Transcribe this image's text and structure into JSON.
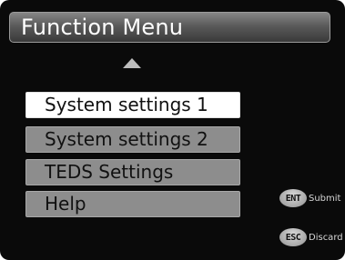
{
  "title": "Function Menu",
  "menu": {
    "items": [
      {
        "label": "System settings 1",
        "selected": true
      },
      {
        "label": "System settings 2",
        "selected": false
      },
      {
        "label": "TEDS Settings",
        "selected": false
      },
      {
        "label": "Help",
        "selected": false
      }
    ]
  },
  "scroll": {
    "up_icon": "triangle-up-icon"
  },
  "keys": {
    "enter": {
      "badge": "ENT",
      "label": "Submit"
    },
    "escape": {
      "badge": "ESC",
      "label": "Discard"
    }
  },
  "colors": {
    "background": "#0a0a0a",
    "item": "#8d8d8d",
    "item_selected": "#ffffff",
    "text": "#111111",
    "title_text": "#ffffff"
  }
}
